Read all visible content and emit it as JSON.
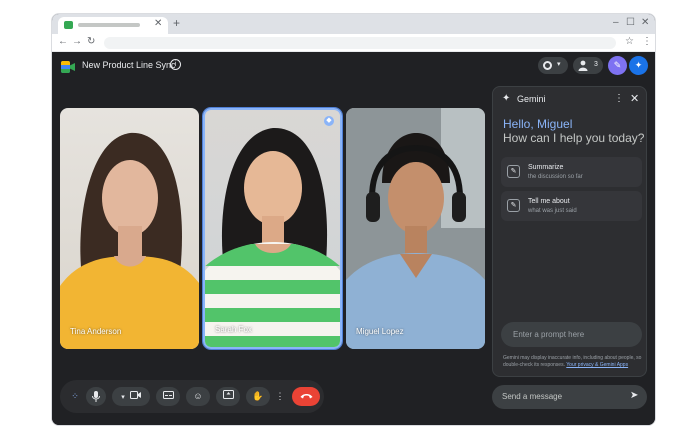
{
  "browser": {
    "tab_close": "✕",
    "new_tab": "+",
    "win_min": "–",
    "win_max": "☐",
    "win_close": "✕",
    "back": "←",
    "forward": "→",
    "reload": "↻",
    "star": "☆",
    "menu": "⋮"
  },
  "meeting": {
    "title": "New Product Line Sync",
    "info_icon": "i",
    "participants_count": "3",
    "header_icons": [
      "record-icon",
      "people-icon",
      "assist-icon",
      "gemini-icon"
    ]
  },
  "participants": [
    {
      "name": "Tina Anderson"
    },
    {
      "name": "Sarah Fox",
      "speaking": true
    },
    {
      "name": "Miguel Lopez"
    }
  ],
  "gemini": {
    "title": "Gemini",
    "greeting": "Hello, Miguel",
    "question": "How can I help you today?",
    "suggestions": [
      {
        "label": "Summarize",
        "sub": "the discussion so far"
      },
      {
        "label": "Tell me about",
        "sub": "what was just said"
      }
    ],
    "prompt_placeholder": "Enter a prompt here",
    "disclaimer": "Gemini may display inaccurate info, including about people, so double-check its responses.",
    "disclaimer_link": "Your privacy & Gemini Apps"
  },
  "chat": {
    "send_placeholder": "Send a message"
  },
  "controls": [
    "wave-icon",
    "mic-icon",
    "chevron-down-icon",
    "camera-icon",
    "captions-icon",
    "emoji-icon",
    "present-icon",
    "hand-icon",
    "more-icon",
    "end-call-icon"
  ],
  "colors": {
    "accent": "#8ab4f8",
    "end_call": "#ea4335",
    "background": "#202124"
  }
}
